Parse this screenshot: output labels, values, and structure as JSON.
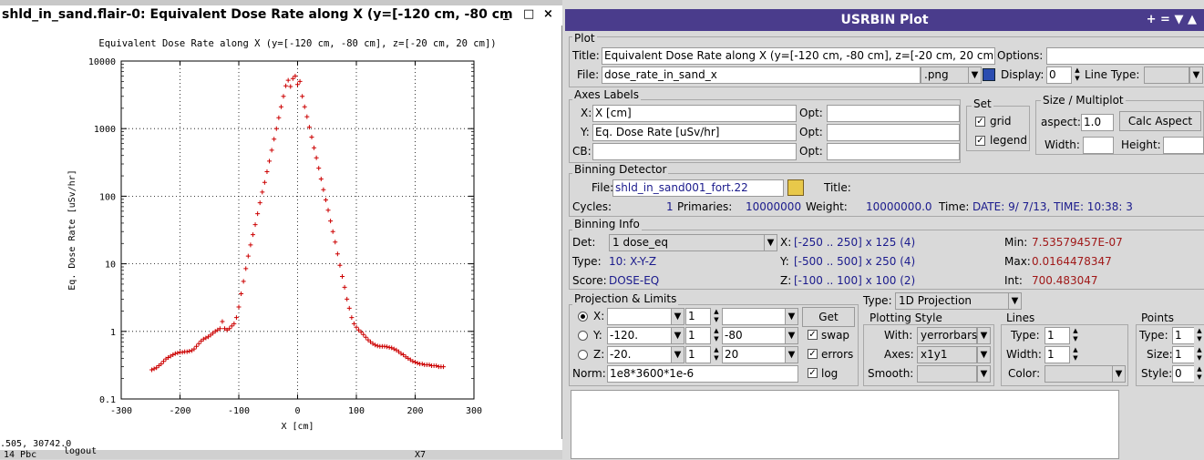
{
  "plot_window": {
    "title": "shld_in_sand.flair-0: Equivalent Dose Rate along X (y=[-120 cm, -80 cm",
    "min_btn": "_",
    "max_btn": "□",
    "close_btn": "×",
    "status": ".505,  30742.0",
    "behind_text_1": "14   Pbc",
    "behind_text_2": "logout",
    "behind_text_3": "X7"
  },
  "chart_data": {
    "type": "scatter",
    "title": "Equivalent Dose Rate along X (y=[-120 cm, -80 cm], z=[-20 cm, 20 cm])",
    "xlabel": "X [cm]",
    "ylabel": "Eq. Dose Rate [uSv/hr]",
    "xlim": [
      -300,
      300
    ],
    "ylim": [
      0.1,
      10000
    ],
    "yscale": "log",
    "grid": true,
    "marker": "+",
    "color": "#cc0000",
    "xticks": [
      "-300",
      "-200",
      "-100",
      "0",
      "100",
      "200",
      "300"
    ],
    "yticks": [
      "0.1",
      "1",
      "10",
      "100",
      "1000",
      "10000"
    ],
    "x": [
      -248,
      -244,
      -240,
      -236,
      -232,
      -228,
      -224,
      -220,
      -216,
      -212,
      -208,
      -204,
      -200,
      -196,
      -192,
      -188,
      -184,
      -180,
      -176,
      -172,
      -168,
      -164,
      -160,
      -156,
      -152,
      -148,
      -144,
      -140,
      -136,
      -132,
      -128,
      -124,
      -120,
      -116,
      -112,
      -108,
      -104,
      -100,
      -96,
      -92,
      -88,
      -84,
      -80,
      -76,
      -72,
      -68,
      -64,
      -60,
      -56,
      -52,
      -48,
      -44,
      -40,
      -36,
      -32,
      -28,
      -24,
      -20,
      -16,
      -12,
      -8,
      -4,
      0,
      4,
      8,
      12,
      16,
      20,
      24,
      28,
      32,
      36,
      40,
      44,
      48,
      52,
      56,
      60,
      64,
      68,
      72,
      76,
      80,
      84,
      88,
      92,
      96,
      100,
      104,
      108,
      112,
      116,
      120,
      124,
      128,
      132,
      136,
      140,
      144,
      148,
      152,
      156,
      160,
      164,
      168,
      172,
      176,
      180,
      184,
      188,
      192,
      196,
      200,
      204,
      208,
      212,
      216,
      220,
      224,
      228,
      232,
      236,
      240,
      244,
      248
    ],
    "y": [
      0.27,
      0.28,
      0.29,
      0.31,
      0.33,
      0.36,
      0.39,
      0.41,
      0.43,
      0.45,
      0.47,
      0.48,
      0.49,
      0.49,
      0.5,
      0.5,
      0.51,
      0.52,
      0.55,
      0.6,
      0.66,
      0.72,
      0.77,
      0.8,
      0.83,
      0.88,
      0.94,
      1.0,
      1.05,
      1.1,
      1.4,
      1.1,
      1.05,
      1.1,
      1.2,
      1.3,
      1.6,
      2.3,
      3.6,
      5.5,
      8.5,
      13,
      19,
      27,
      38,
      55,
      80,
      115,
      160,
      230,
      330,
      480,
      700,
      1000,
      1450,
      2100,
      3000,
      4300,
      5200,
      4200,
      5500,
      6000,
      4500,
      5000,
      3000,
      2100,
      1500,
      1050,
      750,
      520,
      370,
      260,
      180,
      125,
      88,
      62,
      43,
      30,
      21,
      14,
      9.5,
      6.5,
      4.5,
      3.0,
      2.2,
      1.6,
      1.3,
      1.15,
      1.05,
      0.98,
      0.9,
      0.82,
      0.75,
      0.7,
      0.66,
      0.63,
      0.61,
      0.6,
      0.6,
      0.6,
      0.59,
      0.58,
      0.57,
      0.55,
      0.53,
      0.5,
      0.47,
      0.45,
      0.42,
      0.4,
      0.38,
      0.36,
      0.35,
      0.34,
      0.33,
      0.33,
      0.32,
      0.32,
      0.32,
      0.31,
      0.31,
      0.31,
      0.3,
      0.3,
      0.3
    ]
  },
  "usrbin": {
    "title": "USRBIN Plot",
    "title_controls": "+ = ▼ ▲",
    "plot": {
      "group": "Plot",
      "title_label": "Title:",
      "title_value": "Equivalent Dose Rate along X (y=[-120 cm, -80 cm], z=[-20 cm, 20 cm",
      "options_label": "Options:",
      "options_value": "",
      "file_label": "File:",
      "file_value": "dose_rate_in_sand_x",
      "format_value": ".png",
      "display_label": "Display:",
      "display_value": "0",
      "linetype_label": "Line Type:",
      "linetype_value": ""
    },
    "axes_labels": {
      "group": "Axes Labels",
      "x_label": "X:",
      "x_value": "X [cm]",
      "y_label": "Y:",
      "y_value": "Eq. Dose Rate [uSv/hr]",
      "cb_label": "CB:",
      "cb_value": "",
      "opt_label": "Opt:"
    },
    "set": {
      "group": "Set",
      "grid": "grid",
      "legend": "legend"
    },
    "size": {
      "group": "Size / Multiplot",
      "aspect_label": "aspect:",
      "aspect_value": "1.0",
      "calc_aspect": "Calc Aspect",
      "width_label": "Width:",
      "height_label": "Height:"
    },
    "binning_detector": {
      "group": "Binning Detector",
      "file_label": "File:",
      "file_value": "shld_in_sand001_fort.22",
      "title_label": "Title:",
      "cycles_label": "Cycles:",
      "cycles_value": "1",
      "primaries_label": "Primaries:",
      "primaries_value": "10000000",
      "weight_label": "Weight:",
      "weight_value": "10000000.0",
      "time_label": "Time:",
      "time_value": "DATE:  9/ 7/13,  TIME: 10:38: 3"
    },
    "binning_info": {
      "group": "Binning Info",
      "det_label": "Det:",
      "det_value": "1 dose_eq",
      "type_label": "Type:",
      "type_value": "10: X-Y-Z",
      "score_label": "Score:",
      "score_value": "DOSE-EQ",
      "x_label": "X:",
      "x_value": "[-250 .. 250] x 125 (4)",
      "y_label": "Y:",
      "y_value": "[-500 .. 500] x 250 (4)",
      "z_label": "Z:",
      "z_value": "[-100 .. 100] x 100 (2)",
      "min_label": "Min:",
      "min_value": "7.53579457E-07",
      "max_label": "Max:",
      "max_value": "0.0164478347",
      "int_label": "Int:",
      "int_value": "700.483047"
    },
    "projection": {
      "group": "Projection & Limits",
      "type_label": "Type:",
      "type_value": "1D Projection",
      "x_label": "X:",
      "x_min": "",
      "x_reb": "1",
      "x_max": "",
      "get": "Get",
      "y_label": "Y:",
      "y_min": "-120.",
      "y_reb": "1",
      "y_max": "-80",
      "swap": "swap",
      "z_label": "Z:",
      "z_min": "-20.",
      "z_reb": "1",
      "z_max": "20",
      "errors": "errors",
      "norm_label": "Norm:",
      "norm_value": "1e8*3600*1e-6",
      "log": "log"
    },
    "plotting_style": {
      "group": "Plotting Style",
      "with_label": "With:",
      "with_value": "yerrorbars",
      "axes_label": "Axes:",
      "axes_value": "x1y1",
      "smooth_label": "Smooth:",
      "smooth_value": ""
    },
    "lines": {
      "group": "Lines",
      "type_label": "Type:",
      "type_value": "1",
      "width_label": "Width:",
      "width_value": "1",
      "color_label": "Color:",
      "color_value": ""
    },
    "points": {
      "group": "Points",
      "type_label": "Type:",
      "type_value": "1",
      "size_label": "Size:",
      "size_value": "1",
      "style_label": "Style:",
      "style_value": "0"
    }
  }
}
